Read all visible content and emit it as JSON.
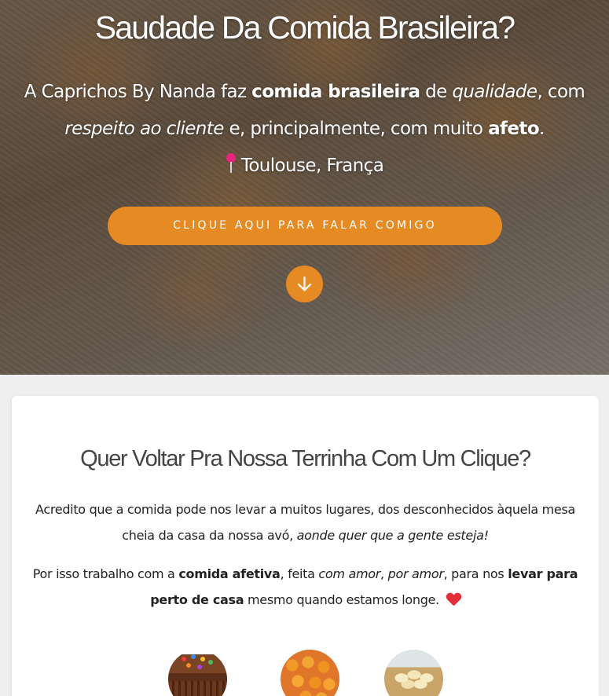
{
  "hero": {
    "title": "Saudade Da Comida Brasileira?",
    "line1_prefix": "A Caprichos By Nanda faz ",
    "line1_bold": "comida brasileira",
    "line1_mid": " de ",
    "line1_italic": "qualidade",
    "line1_suffix": ", com",
    "line2_italic": "respeito ao cliente",
    "line2_mid": " e, principalmente, com muito ",
    "line2_bold": "afeto",
    "line2_suffix": ".",
    "location": "Toulouse, França",
    "location_icon": "pushpin-icon",
    "cta_label": "CLIQUE AQUI PARA FALAR COMIGO",
    "scroll_icon": "arrow-down-icon",
    "accent_color": "#e68a24"
  },
  "section": {
    "title": "Quer Voltar Pra Nossa Terrinha Com Um Clique?",
    "p1_text": "Acredito que a comida pode nos levar a muitos lugares, dos desconhecidos àquela mesa cheia da casa da nossa avó, ",
    "p1_italic": "aonde quer que a gente esteja!",
    "p2_a": "Por isso trabalho com a ",
    "p2_bold1": "comida afetiva",
    "p2_b": ", feita ",
    "p2_italic1": "com amor",
    "p2_c": ", ",
    "p2_italic2": "por amor",
    "p2_d": ", para nos ",
    "p2_bold2": "levar para perto de casa",
    "p2_e": " mesmo quando estamos longe. ",
    "heart_icon": "heart-icon",
    "images": [
      "cake-image",
      "brigadeiro-image",
      "bread-basket-image"
    ]
  }
}
